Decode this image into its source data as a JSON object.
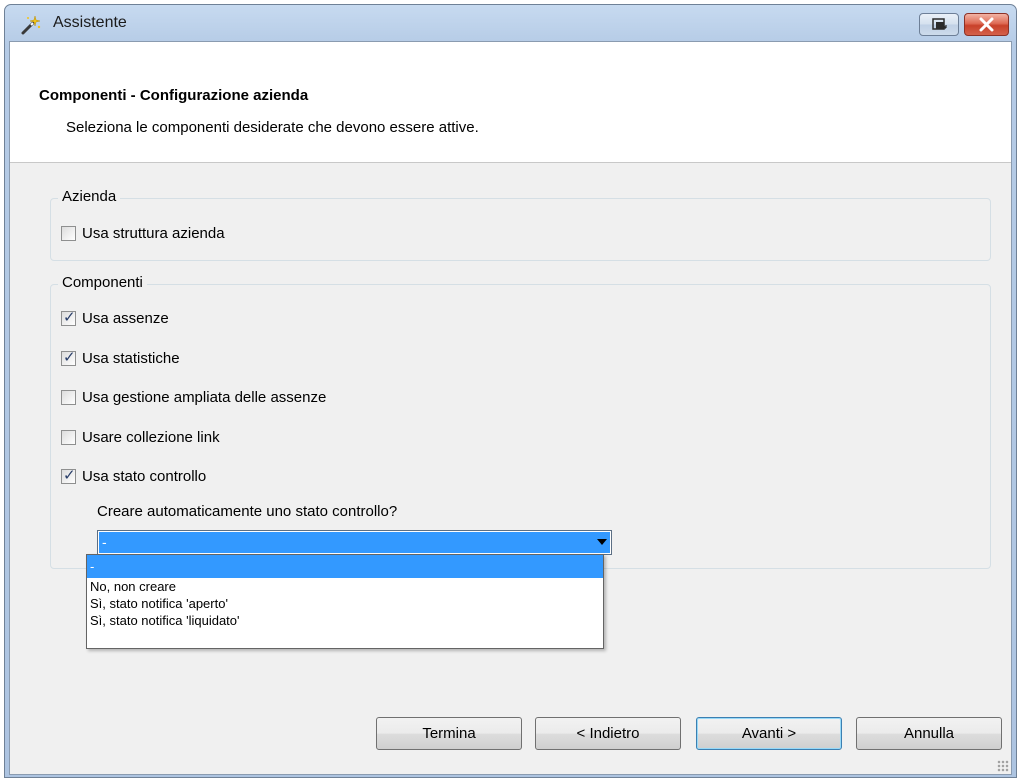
{
  "window": {
    "title": "Assistente"
  },
  "header": {
    "title": "Componenti - Configurazione azienda",
    "subtitle": "Seleziona le componenti desiderate che devono essere attive."
  },
  "azienda_group": {
    "label": "Azienda",
    "use_structure": {
      "label": "Usa struttura azienda",
      "checked": false
    }
  },
  "componenti_group": {
    "label": "Componenti",
    "items": [
      {
        "label": "Usa assenze",
        "checked": true
      },
      {
        "label": "Usa statistiche",
        "checked": true
      },
      {
        "label": "Usa gestione ampliata delle assenze",
        "checked": false
      },
      {
        "label": "Usare collezione link",
        "checked": false
      },
      {
        "label": "Usa stato controllo",
        "checked": true
      }
    ],
    "prompt": "Creare automaticamente uno stato controllo?",
    "combo_value": "-",
    "dropdown_options": [
      "-",
      "No, non creare",
      "Sì, stato notifica 'aperto'",
      "Sì, stato notifica 'liquidato'"
    ]
  },
  "buttons": {
    "finish": "Termina",
    "back": "< Indietro",
    "next": "Avanti >",
    "cancel": "Annulla"
  },
  "colors": {
    "selection": "#3399ff",
    "frame": "#b5cbe6",
    "close_button": "#c8412a"
  },
  "icons": {
    "app": "wizard-wand-icon",
    "restore": "restore-window-icon",
    "close": "close-icon",
    "combo_arrow": "chevron-down-icon",
    "resize": "resize-grip-icon"
  }
}
